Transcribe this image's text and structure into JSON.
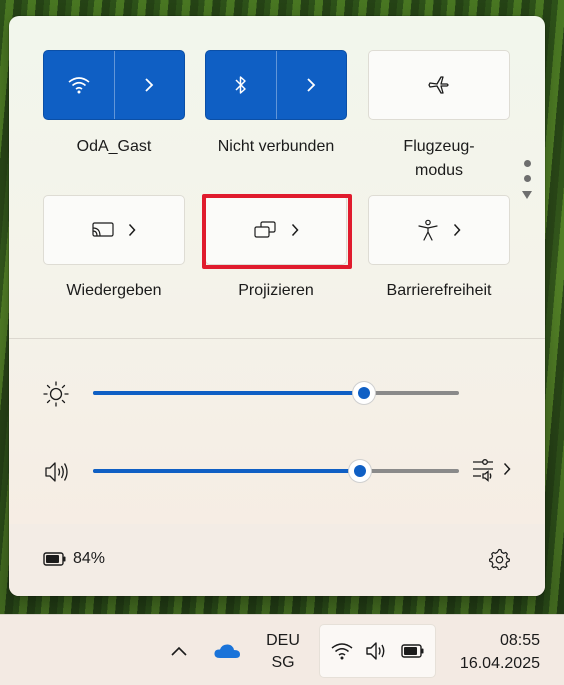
{
  "quick_settings": {
    "tiles": [
      {
        "label": "OdA_Gast",
        "icon": "wifi-icon",
        "state": "on"
      },
      {
        "label": "Nicht verbunden",
        "icon": "bluetooth-icon",
        "state": "on"
      },
      {
        "label_line1": "Flugzeug-",
        "label_line2": "modus",
        "icon": "airplane-icon",
        "state": "off"
      },
      {
        "label": "Wiedergeben",
        "icon": "cast-icon",
        "state": "off"
      },
      {
        "label": "Projizieren",
        "icon": "project-icon",
        "state": "off",
        "highlighted": true
      },
      {
        "label": "Barrierefreiheit",
        "icon": "accessibility-icon",
        "state": "off"
      }
    ],
    "page_dots": 2
  },
  "brightness": {
    "icon": "sun-icon",
    "value_percent": 74
  },
  "volume": {
    "icon": "speaker-icon",
    "value_percent": 73,
    "mixer_icon": "volume-mixer-icon"
  },
  "footer": {
    "battery_text": "84%",
    "battery_level": 0.84,
    "settings_icon": "gear-icon"
  },
  "taskbar": {
    "language_line1": "DEU",
    "language_line2": "SG",
    "time": "08:55",
    "date": "16.04.2025",
    "tray_icons": [
      "chevron-up-icon",
      "onedrive-icon",
      "wifi-icon",
      "speaker-icon",
      "battery-icon"
    ]
  },
  "colors": {
    "accent": "#0f5fc4",
    "highlight": "#e01b2d"
  }
}
